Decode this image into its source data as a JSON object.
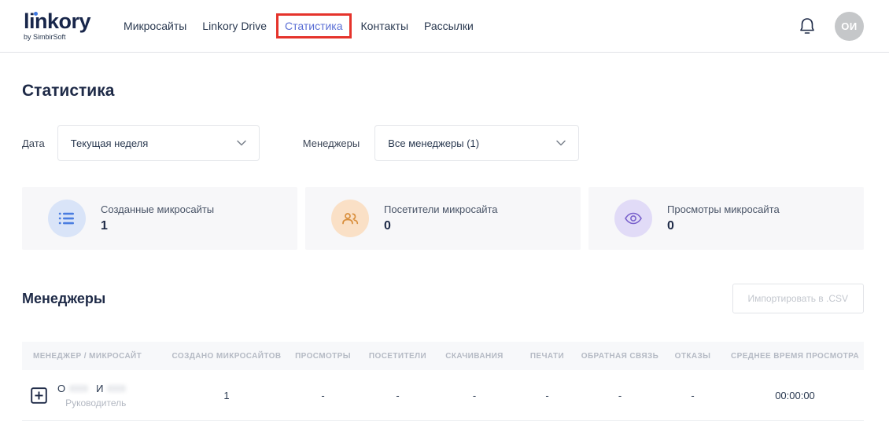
{
  "brand": {
    "logo_text": "linkory",
    "logo_sub": "by SimbirSoft"
  },
  "nav": {
    "items": [
      {
        "label": "Микросайты",
        "active": false
      },
      {
        "label": "Linkory Drive",
        "active": false
      },
      {
        "label": "Статистика",
        "active": true
      },
      {
        "label": "Контакты",
        "active": false
      },
      {
        "label": "Рассылки",
        "active": false
      }
    ],
    "avatar_initials": "ОИ"
  },
  "page": {
    "title": "Статистика"
  },
  "filters": {
    "date": {
      "label": "Дата",
      "value": "Текущая неделя"
    },
    "managers": {
      "label": "Менеджеры",
      "value": "Все менеджеры (1)"
    }
  },
  "stat_cards": [
    {
      "icon": "list-icon",
      "label": "Созданные микросайты",
      "value": "1"
    },
    {
      "icon": "people-icon",
      "label": "Посетители микросайта",
      "value": "0"
    },
    {
      "icon": "eye-icon",
      "label": "Просмотры микросайта",
      "value": "0"
    }
  ],
  "managers_section": {
    "title": "Менеджеры",
    "export_button_label": "Импортировать в .CSV"
  },
  "table": {
    "headers": [
      "МЕНЕДЖЕР / МИКРОСАЙТ",
      "СОЗДАНО МИКРОСАЙТОВ",
      "ПРОСМОТРЫ",
      "ПОСЕТИТЕЛИ",
      "СКАЧИВАНИЯ",
      "ПЕЧАТИ",
      "ОБРАТНАЯ СВЯЗЬ",
      "ОТКАЗЫ",
      "СРЕДНЕЕ ВРЕМЯ ПРОСМОТРА"
    ],
    "rows": [
      {
        "manager_first_initial": "О",
        "manager_second_initial": "И",
        "role": "Руководитель",
        "created": "1",
        "views": "-",
        "visitors": "-",
        "downloads": "-",
        "prints": "-",
        "feedback": "-",
        "bounces": "-",
        "avg_time": "00:00:00"
      }
    ]
  },
  "colors": {
    "accent_active_nav": "#5b6fd5",
    "annotation_red": "#e5332b",
    "card_icon_blue": "#4a7de0",
    "card_icon_orange": "#d98f3d",
    "card_icon_purple": "#7a62cc",
    "dark_navy": "#1e2a47"
  }
}
